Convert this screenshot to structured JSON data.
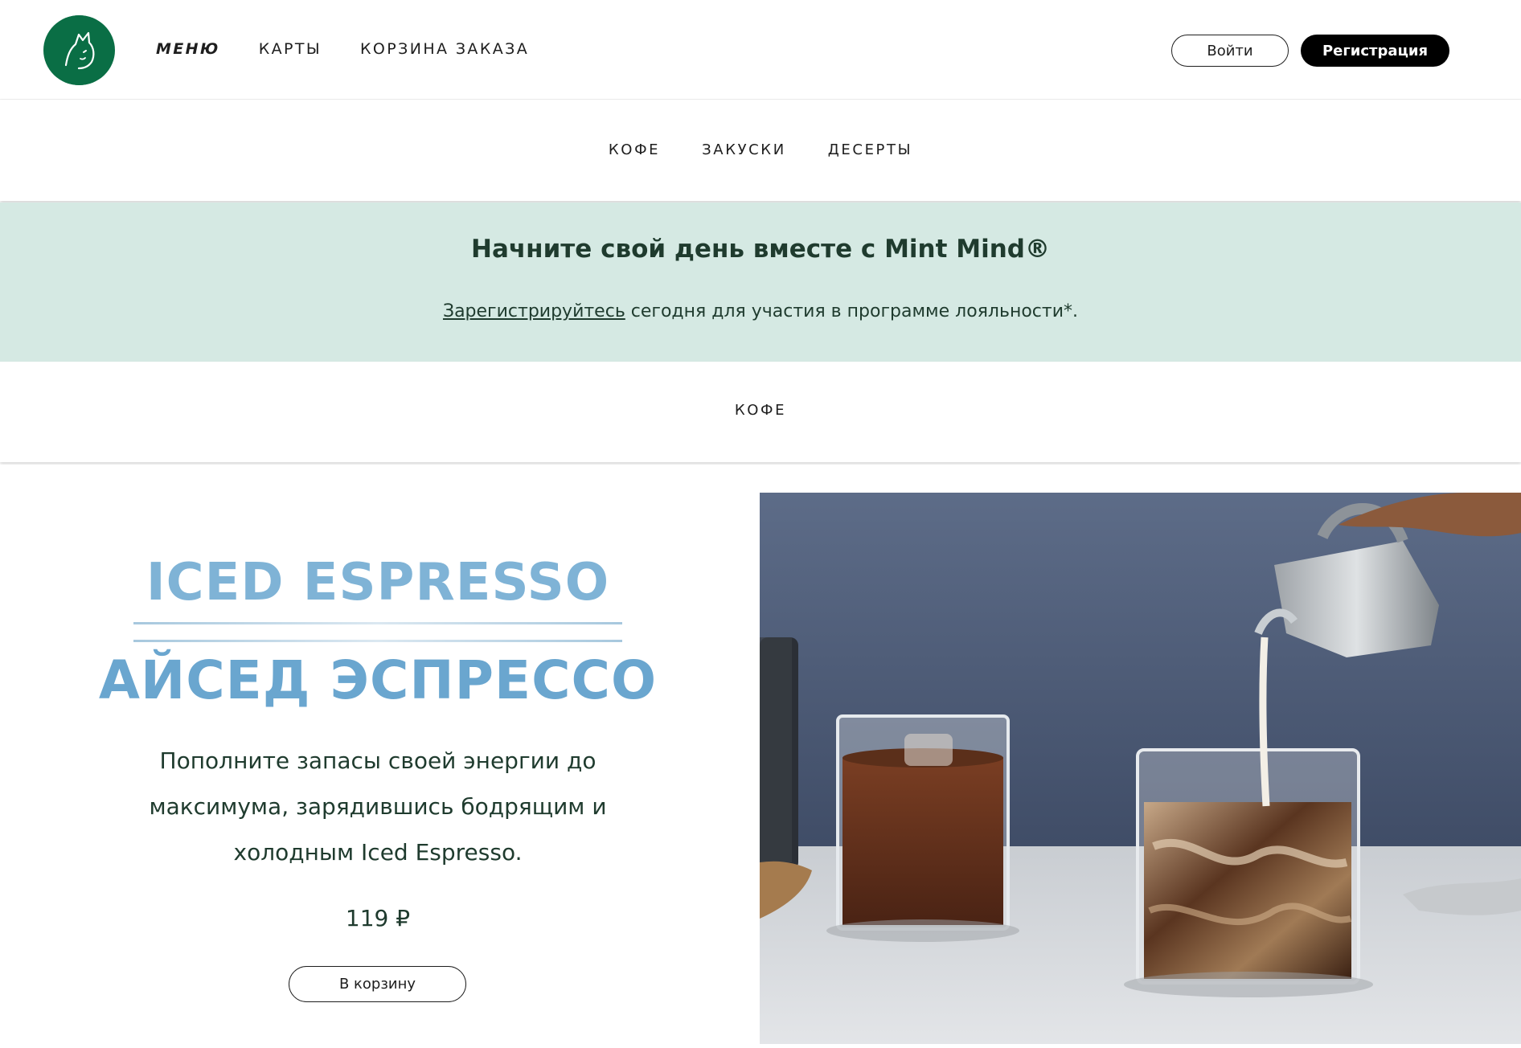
{
  "header": {
    "logo_icon": "cat-head-logo",
    "nav": [
      {
        "label": "МЕНЮ",
        "active": true
      },
      {
        "label": "КАРТЫ",
        "active": false
      },
      {
        "label": "КОРЗИНА ЗАКАЗА",
        "active": false
      }
    ],
    "login_label": "Войти",
    "register_label": "Регистрация"
  },
  "categories": [
    "КОФЕ",
    "ЗАКУСКИ",
    "ДЕСЕРТЫ"
  ],
  "promo": {
    "title": "Начните свой день вместе с Mint Mind®",
    "link_text": "Зарегистрируйтесь",
    "text_rest": " сегодня для участия в программе лояльности*."
  },
  "section": {
    "title": "КОФЕ"
  },
  "product": {
    "title_en": "ICED ESPRESSO",
    "title_ru": "АЙСЕД ЭСПРЕССО",
    "description": "Пополните запасы своей энергии до максимума, зарядившись бодрящим и холодным Iced Espresso.",
    "price": "119 ₽",
    "cart_button": "В корзину",
    "image_icon": "iced-espresso-photo"
  },
  "colors": {
    "brand_green": "#0a6e45",
    "promo_bg": "#d5e9e3",
    "title_blue": "#7fb3d6"
  }
}
